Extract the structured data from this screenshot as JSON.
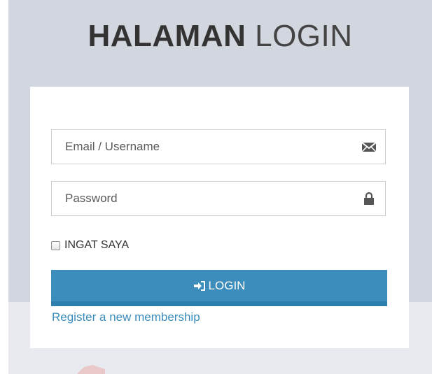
{
  "title": {
    "bold": "HALAMAN",
    "light": "LOGIN"
  },
  "form": {
    "email": {
      "placeholder": "Email / Username",
      "value": "",
      "icon": "envelope-icon"
    },
    "password": {
      "placeholder": "Password",
      "value": "",
      "icon": "lock-icon"
    },
    "remember": {
      "label": "INGAT SAYA",
      "checked": false
    },
    "login_button": {
      "label": "LOGIN",
      "icon": "sign-in-icon"
    },
    "register_link": "Register a new membership"
  },
  "colors": {
    "background": "#d2d6de",
    "accent": "#3c8dbc",
    "card": "#ffffff",
    "text": "#333333"
  }
}
